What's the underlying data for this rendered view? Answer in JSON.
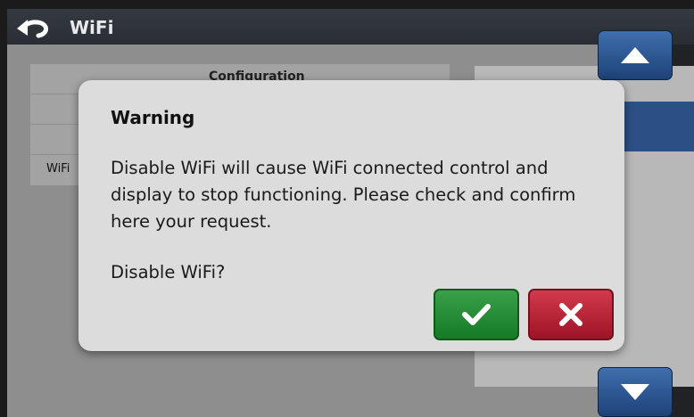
{
  "header": {
    "title": "WiFi",
    "back_icon": "back-arrow-icon"
  },
  "config": {
    "header": "Configuration",
    "wifi_label": "WiFi"
  },
  "nav": {
    "up_icon": "triangle-up-icon",
    "down_icon": "triangle-down-icon"
  },
  "dialog": {
    "title": "Warning",
    "message": "Disable WiFi will cause WiFi connected control and display to stop functioning. Please check and confirm here your request.",
    "question": "Disable WiFi?",
    "confirm_icon": "checkmark-icon",
    "cancel_icon": "x-icon"
  },
  "colors": {
    "accent_blue": "#2c5a96",
    "confirm_green": "#1f8a30",
    "cancel_red": "#b81c30"
  }
}
